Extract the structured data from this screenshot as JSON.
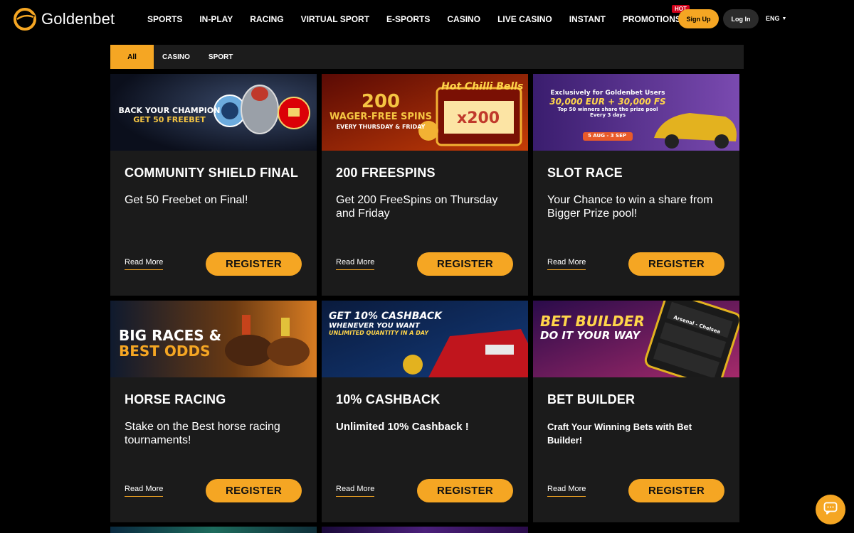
{
  "header": {
    "logo_text": "Goldenbet",
    "nav": [
      "SPORTS",
      "IN-PLAY",
      "RACING",
      "VIRTUAL SPORT",
      "E-SPORTS",
      "CASINO",
      "LIVE CASINO",
      "INSTANT",
      "PROMOTIONS"
    ],
    "hot_badge": "HOT",
    "signup": "Sign Up",
    "login": "Log In",
    "lang": "ENG"
  },
  "tabs": [
    "All",
    "CASINO",
    "SPORT"
  ],
  "cards": [
    {
      "banner_lines": [
        "BACK YOUR CHAMPION",
        "GET 50 FREEBET"
      ],
      "title": "COMMUNITY SHIELD FINAL",
      "desc": "Get 50 Freebet on Final!",
      "read_more": "Read More",
      "register": "REGISTER"
    },
    {
      "banner_lines": [
        "200",
        "WAGER-FREE SPINS",
        "EVERY THURSDAY & FRIDAY",
        "Hot Chilli Bells",
        "x200"
      ],
      "title": "200 FREESPINS",
      "desc": "Get 200 FreeSpins on Thursday and Friday",
      "read_more": "Read More",
      "register": "REGISTER"
    },
    {
      "banner_lines": [
        "Exclusively for Goldenbet Users",
        "30,000 EUR + 30,000 FS",
        "Top 50 winners share the prize pool",
        "Every 3 days",
        "5 AUG - 3 SEP"
      ],
      "title": "SLOT RACE",
      "desc": "Your Chance to win a share from Bigger Prize pool!",
      "read_more": "Read More",
      "register": "REGISTER"
    },
    {
      "banner_lines": [
        "BIG RACES &",
        "BEST ODDS"
      ],
      "title": "HORSE RACING",
      "desc": "Stake on the Best horse racing tournaments!",
      "read_more": "Read More",
      "register": "REGISTER"
    },
    {
      "banner_lines": [
        "GET 10% CASHBACK",
        "WHENEVER YOU WANT",
        "UNLIMITED QUANTITY IN A DAY"
      ],
      "title": "10% CASHBACK",
      "desc": "Unlimited 10% Cashback !",
      "read_more": "Read More",
      "register": "REGISTER"
    },
    {
      "banner_lines": [
        "BET BUILDER",
        "DO IT YOUR WAY",
        "Arsenal - Chelsea"
      ],
      "title": "BET BUILDER",
      "desc": "Craft Your Winning Bets with Bet Builder!",
      "read_more": "Read More",
      "register": "REGISTER"
    }
  ],
  "colors": {
    "accent": "#f5a623",
    "card_bg": "#1b1b1b",
    "page_bg": "#000000"
  },
  "icons": {
    "chat": "chat-bubble-icon",
    "lang_caret": "caret-down-icon"
  }
}
